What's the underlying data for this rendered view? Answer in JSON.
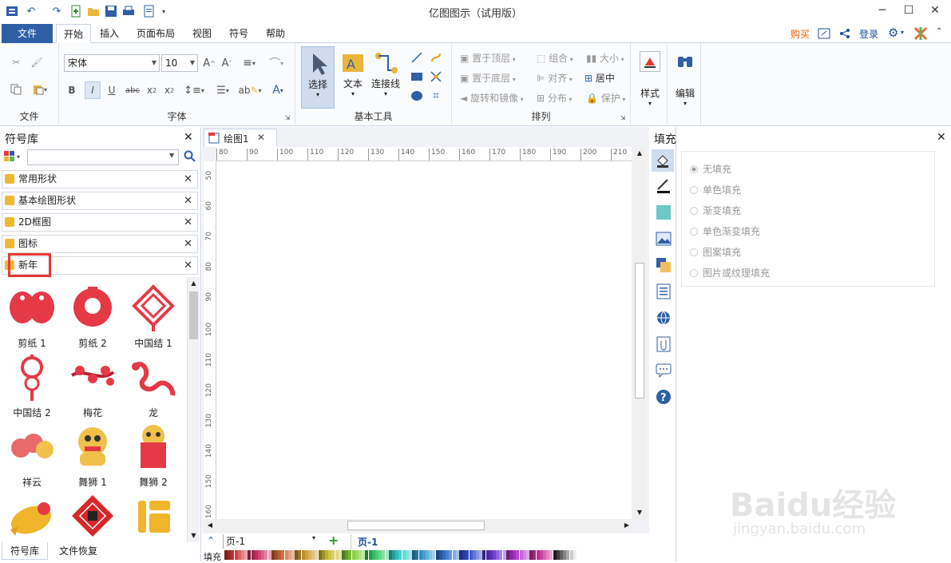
{
  "app": {
    "title": "亿图图示（试用版）"
  },
  "window": {
    "minimize": "─",
    "maximize": "☐",
    "close": "✕"
  },
  "menu": {
    "file": "文件",
    "tabs": [
      "开始",
      "插入",
      "页面布局",
      "视图",
      "符号",
      "帮助"
    ],
    "right": {
      "buy": "购买",
      "login": "登录"
    }
  },
  "ribbon": {
    "file_group": {
      "label": "文件"
    },
    "font_group": {
      "font": "宋体",
      "size": "10",
      "label": "字体"
    },
    "basic_tools": {
      "select": "选择",
      "text": "文本",
      "connector": "连接线",
      "label": "基本工具"
    },
    "arrange": {
      "bring_front": "置于顶层",
      "group": "组合",
      "size": "大小",
      "send_back": "置于底层",
      "align": "对齐",
      "center": "居中",
      "rotate": "旋转和镜像",
      "distribute": "分布",
      "protect": "保护",
      "label": "排列"
    },
    "style": "样式",
    "edit": "编辑"
  },
  "library": {
    "title": "符号库",
    "search_placeholder": "",
    "categories": [
      "常用形状",
      "基本绘图形状",
      "2D框图",
      "图标",
      "新年"
    ],
    "shapes": [
      "剪纸 1",
      "剪纸 2",
      "中国结 1",
      "中国结 2",
      "梅花",
      "龙",
      "祥云",
      "舞狮 1",
      "舞狮 2"
    ],
    "bottom_tabs": [
      "符号库",
      "文件恢复"
    ]
  },
  "document": {
    "tab": "绘图1",
    "ruler_h": [
      "80",
      "90",
      "100",
      "110",
      "120",
      "130",
      "140",
      "150",
      "160",
      "170",
      "180",
      "190",
      "200",
      "210"
    ],
    "ruler_v": [
      "50",
      "60",
      "70",
      "80",
      "90",
      "100",
      "110",
      "120",
      "130",
      "140",
      "150",
      "160"
    ],
    "page_select": "页-1",
    "page_tab": "页-1",
    "fill_label": "填充"
  },
  "fill_panel": {
    "title": "填充",
    "options": [
      "无填充",
      "单色填充",
      "渐变填充",
      "单色渐变填充",
      "图案填充",
      "图片或纹理填充"
    ],
    "selected": "无填充"
  },
  "watermark": {
    "text": "Baidu经验",
    "url": "jingyan.baidu.com"
  },
  "colors": {
    "accent": "#2f5fa5",
    "highlight_box": "#e53935",
    "buy": "#e66000",
    "login": "#1a4fa0"
  }
}
